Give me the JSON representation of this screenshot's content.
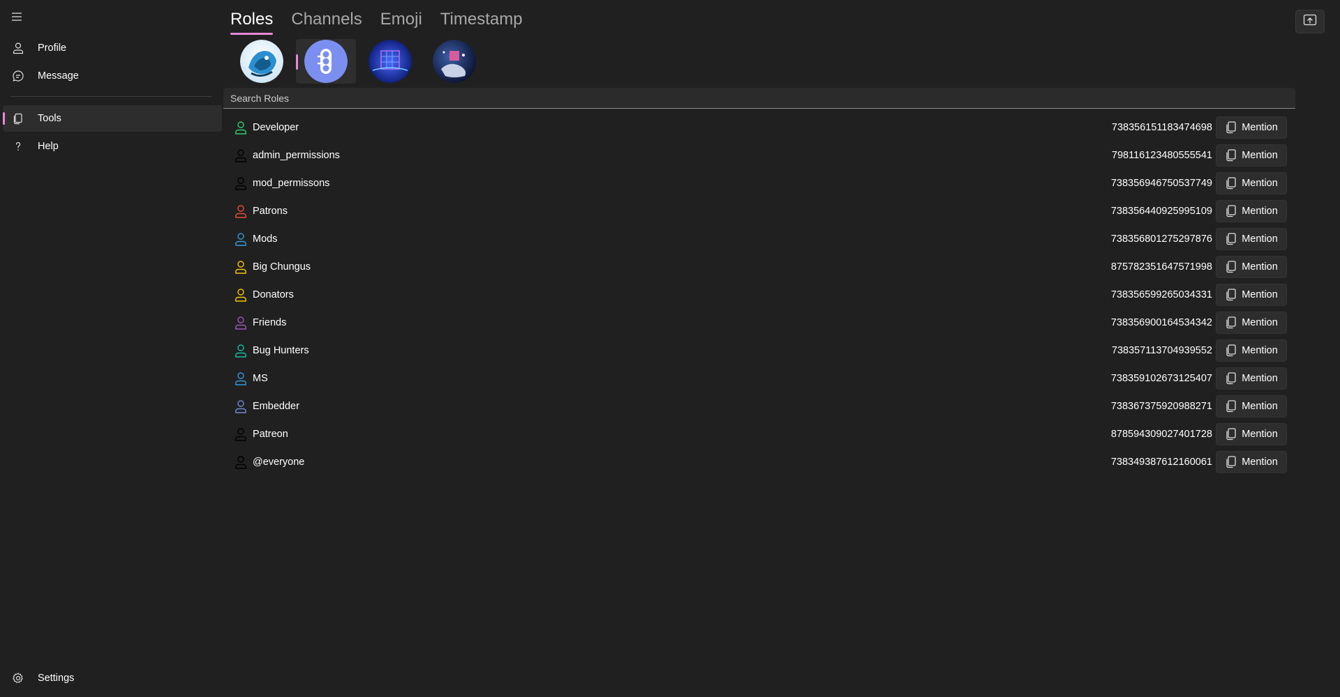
{
  "sidebar": {
    "items": [
      {
        "label": "Profile",
        "icon": "person-icon"
      },
      {
        "label": "Message",
        "icon": "chat-icon"
      },
      {
        "label": "Tools",
        "icon": "copy-icon",
        "active": true
      },
      {
        "label": "Help",
        "icon": "question-icon"
      }
    ],
    "settings_label": "Settings"
  },
  "tabs": [
    {
      "label": "Roles",
      "active": true
    },
    {
      "label": "Channels"
    },
    {
      "label": "Emoji"
    },
    {
      "label": "Timestamp"
    }
  ],
  "servers": [
    {
      "name": "server-1",
      "active": false
    },
    {
      "name": "server-2",
      "active": true
    },
    {
      "name": "server-3",
      "active": false
    },
    {
      "name": "server-4",
      "active": false
    }
  ],
  "search": {
    "placeholder": "Search Roles"
  },
  "roles": [
    {
      "name": "Developer",
      "id": "738356151183474698",
      "color": "#2ecc71"
    },
    {
      "name": "admin_permissions",
      "id": "798116123480555541",
      "color": "#000000"
    },
    {
      "name": "mod_permissons",
      "id": "738356946750537749",
      "color": "#000000"
    },
    {
      "name": "Patrons",
      "id": "738356440925995109",
      "color": "#e74c3c"
    },
    {
      "name": "Mods",
      "id": "738356801275297876",
      "color": "#3498db"
    },
    {
      "name": "Big Chungus",
      "id": "875782351647571998",
      "color": "#f1c40f"
    },
    {
      "name": "Donators",
      "id": "738356599265034331",
      "color": "#f1c40f"
    },
    {
      "name": "Friends",
      "id": "738356900164534342",
      "color": "#9b59b6"
    },
    {
      "name": "Bug Hunters",
      "id": "738357113704939552",
      "color": "#1abc9c"
    },
    {
      "name": "MS",
      "id": "738359102673125407",
      "color": "#3498db"
    },
    {
      "name": "Embedder",
      "id": "738367375920988271",
      "color": "#7289da"
    },
    {
      "name": "Patreon",
      "id": "878594309027401728",
      "color": "#000000"
    },
    {
      "name": "@everyone",
      "id": "738349387612160061",
      "color": "#000000"
    }
  ],
  "mention_label": "Mention",
  "colors": {
    "accent": "#e58ad7",
    "background": "#202020"
  }
}
